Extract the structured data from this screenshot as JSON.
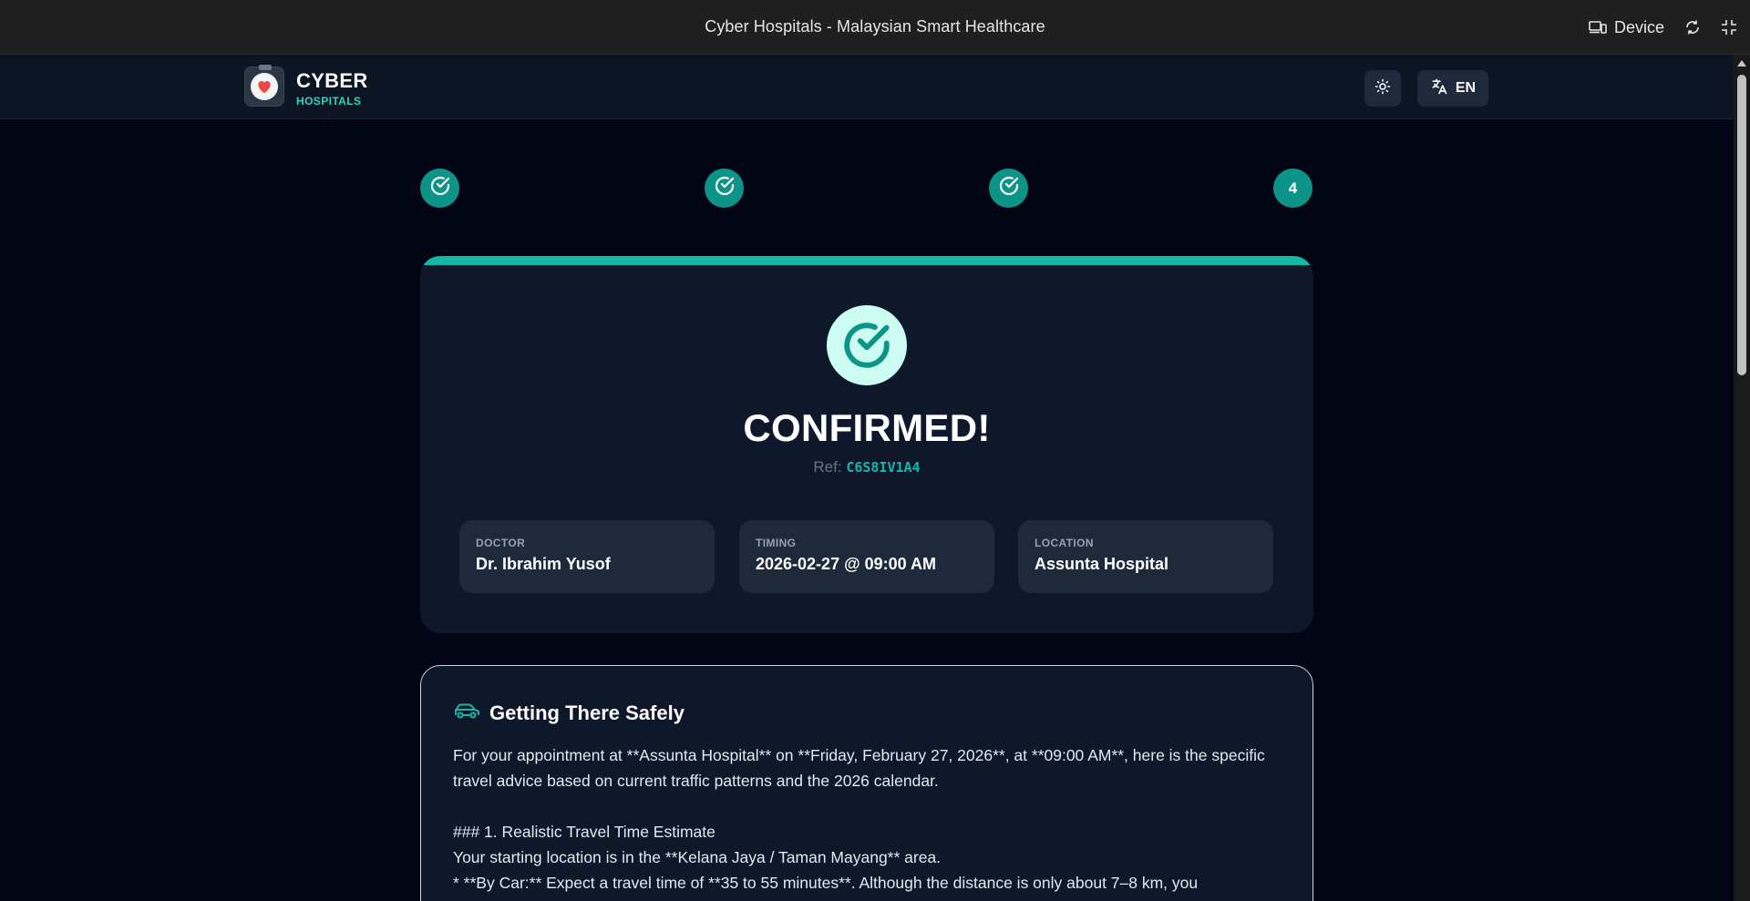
{
  "window": {
    "title": "Cyber Hospitals - Malaysian Smart Healthcare",
    "device_label": "Device"
  },
  "brand": {
    "main": "CYBER",
    "sub": "HOSPITALS"
  },
  "header": {
    "language": "EN"
  },
  "stepper": {
    "steps": [
      {
        "state": "complete"
      },
      {
        "state": "complete"
      },
      {
        "state": "complete"
      },
      {
        "state": "current",
        "label": "4"
      }
    ]
  },
  "confirmation": {
    "title": "CONFIRMED!",
    "ref_label": "Ref:",
    "ref_code": "C6S8IV1A4",
    "doctor_label": "DOCTOR",
    "doctor_value": "Dr. Ibrahim Yusof",
    "timing_label": "TIMING",
    "timing_value": "2026-02-27 @ 09:00 AM",
    "location_label": "LOCATION",
    "location_value": "Assunta Hospital"
  },
  "travel": {
    "title": "Getting There Safely",
    "paragraph1": "For your appointment at **Assunta Hospital** on **Friday, February 27, 2026**, at **09:00 AM**, here is the specific travel advice based on current traffic patterns and the 2026 calendar.",
    "heading1": "### 1. Realistic Travel Time Estimate",
    "line1": "Your starting location is in the **Kelana Jaya / Taman Mayang** area.",
    "line2": "* **By Car:** Expect a travel time of **35 to 55 minutes**. Although the distance is only about 7–8 km, you"
  },
  "colors": {
    "accent": "#14b8a6",
    "step": "#0d9488",
    "background": "#010514",
    "card": "#0f172a"
  }
}
